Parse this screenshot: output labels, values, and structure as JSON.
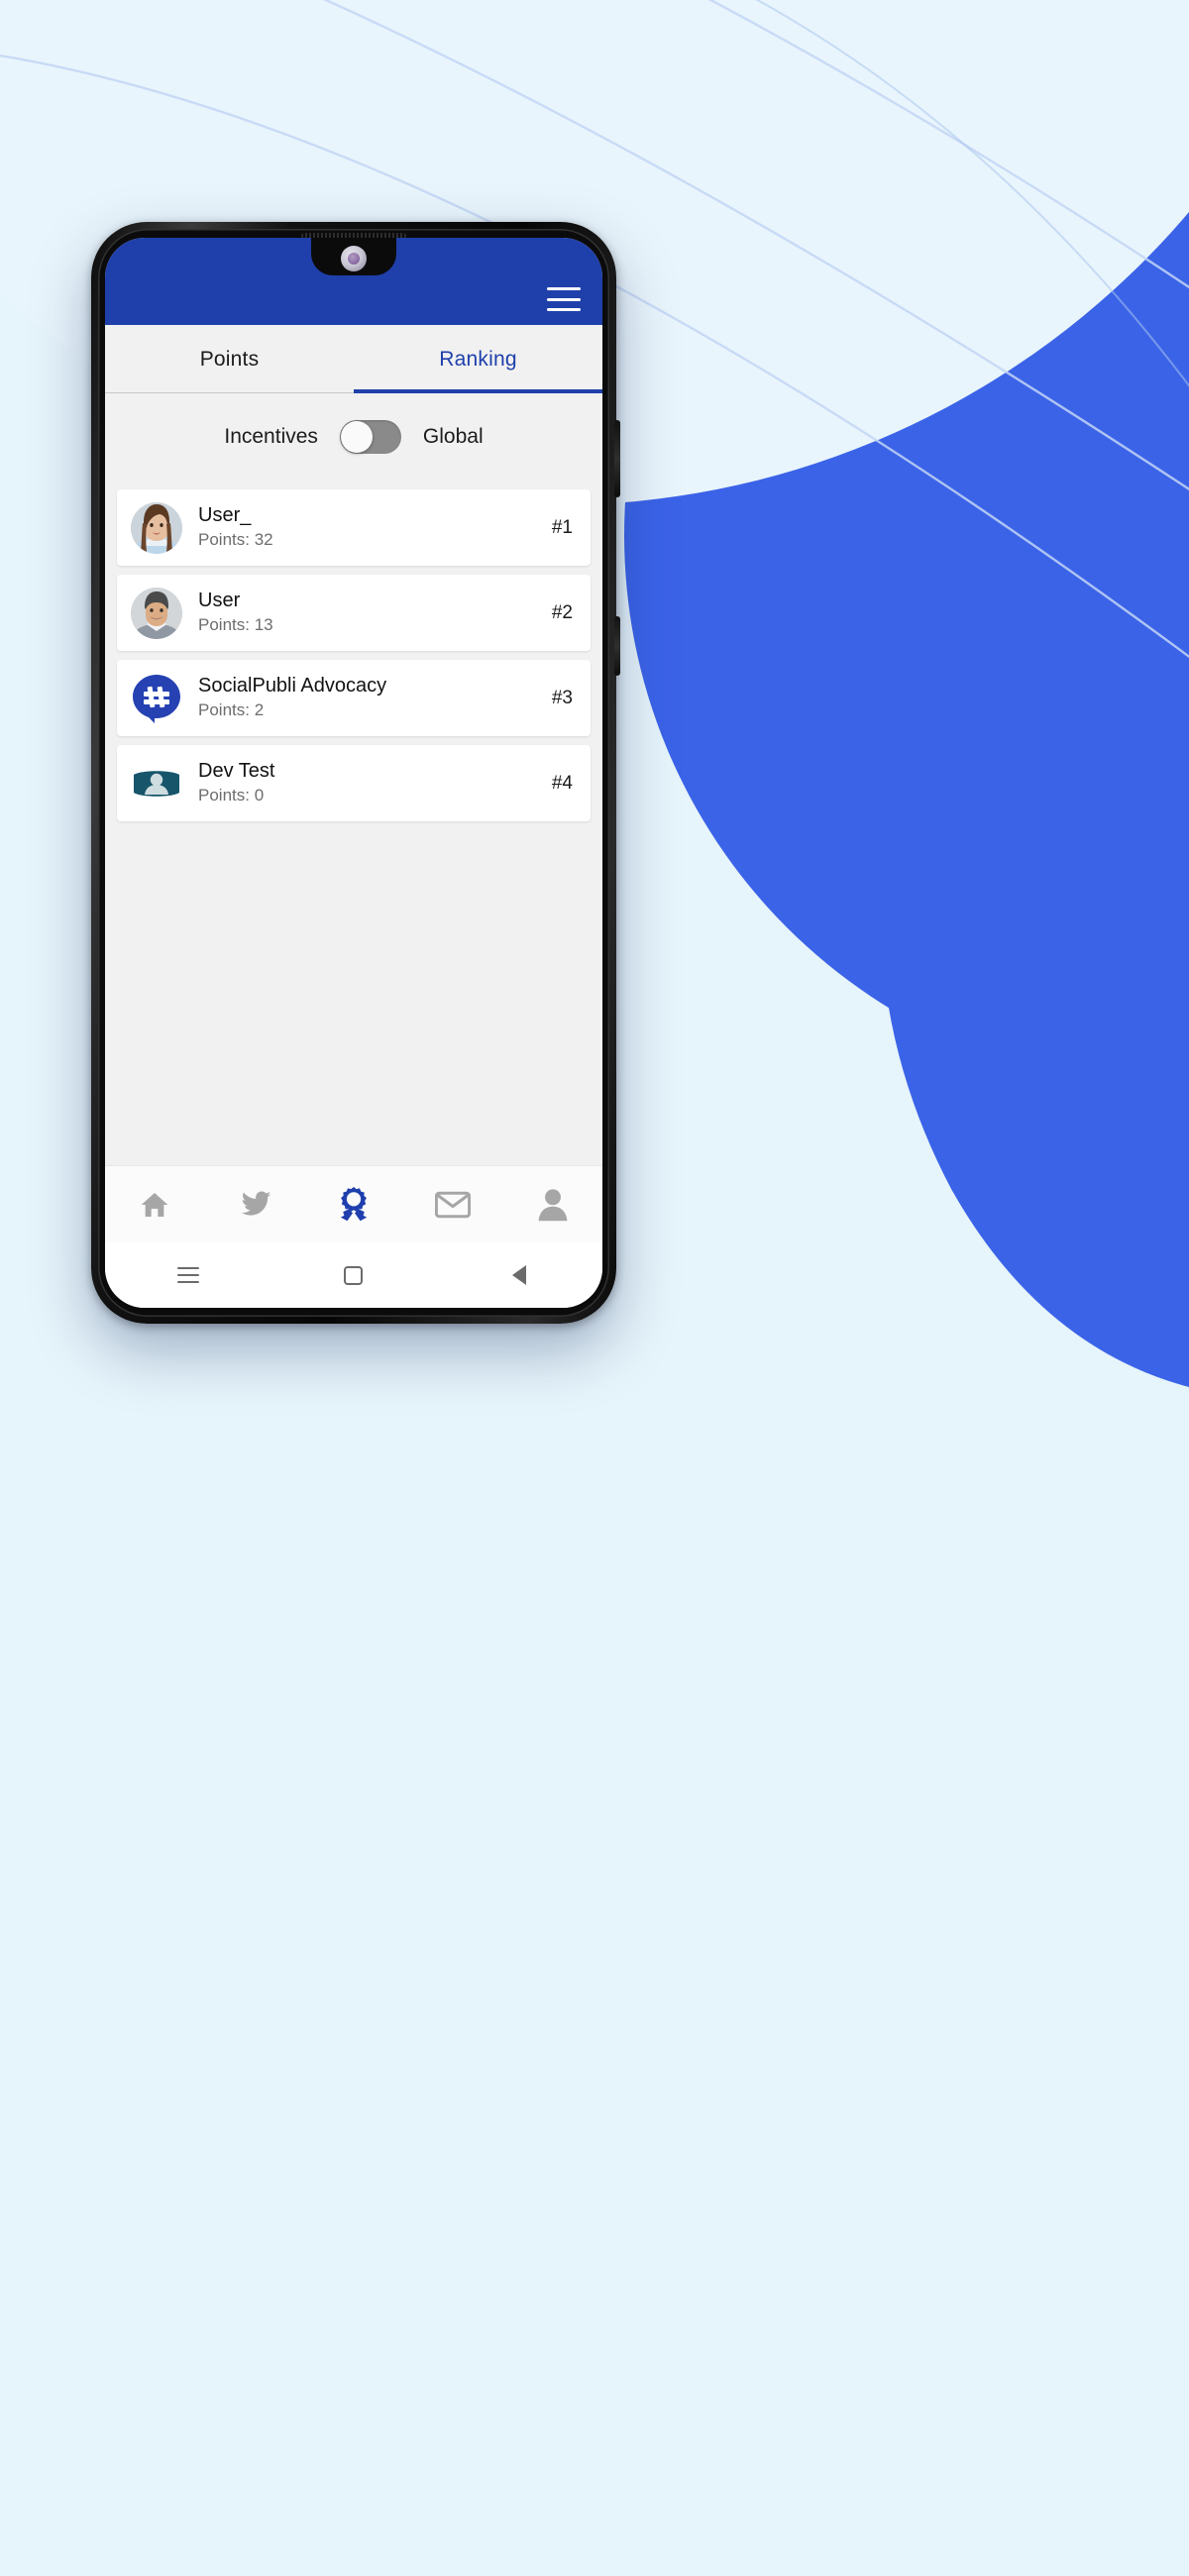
{
  "background": {
    "base_color": "#e6f4fb",
    "blob_color": "#3b63e8",
    "overlay_color": "#e9f5fc",
    "arc_color": "#c3d6f6"
  },
  "device": {
    "frame_color": "#0b0b0c",
    "camera_icon": "front-camera-icon",
    "speaker_icon": "earpiece-speaker-icon"
  },
  "app_header": {
    "background_color": "#1f40ab",
    "menu_icon": "hamburger-menu-icon",
    "menu_label": "Menu"
  },
  "tabs": {
    "active_color": "#1f40ab",
    "inactive_color": "#1c1c1c",
    "items": [
      {
        "label": "Points",
        "active": false
      },
      {
        "label": "Ranking",
        "active": true
      }
    ]
  },
  "filter": {
    "left_label": "Incentives",
    "right_label": "Global",
    "toggle_state": "off",
    "toggle_track_color": "#8a8a8a",
    "toggle_knob_color": "#fafafa"
  },
  "ranking": {
    "points_prefix": "Points:",
    "rows": [
      {
        "name": "User_",
        "points_text": "Points: 32",
        "points": 32,
        "rank": "#1",
        "avatar": "photo-avatar-female"
      },
      {
        "name": "User",
        "points_text": "Points: 13",
        "points": 13,
        "rank": "#2",
        "avatar": "photo-avatar-male"
      },
      {
        "name": "SocialPubli Advocacy",
        "points_text": "Points: 2",
        "points": 2,
        "rank": "#3",
        "avatar": "socialpubli-hashtag-logo"
      },
      {
        "name": "Dev Test",
        "points_text": "Points: 0",
        "points": 0,
        "rank": "#4",
        "avatar": "placeholder-person-avatar"
      }
    ]
  },
  "bottom_nav": {
    "active_color": "#1f3fae",
    "inactive_color": "#a6a6a6",
    "items": [
      {
        "icon": "home-icon",
        "label": "Home",
        "active": false
      },
      {
        "icon": "twitter-bird-icon",
        "label": "Twitter",
        "active": false
      },
      {
        "icon": "award-ribbon-icon",
        "label": "Ranking",
        "active": true
      },
      {
        "icon": "envelope-icon",
        "label": "Messages",
        "active": false
      },
      {
        "icon": "person-icon",
        "label": "Profile",
        "active": false
      }
    ]
  },
  "system_bar": {
    "buttons": [
      {
        "icon": "recents-icon",
        "label": "Recents"
      },
      {
        "icon": "home-square-icon",
        "label": "Home"
      },
      {
        "icon": "back-triangle-icon",
        "label": "Back"
      }
    ]
  }
}
